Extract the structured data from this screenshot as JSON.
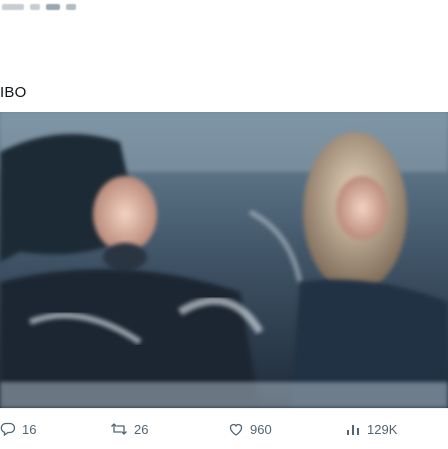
{
  "post": {
    "partial_text": "IBO",
    "media_description": "blurred photo"
  },
  "actions": {
    "replies": "16",
    "reposts": "26",
    "likes": "960",
    "views": "129K"
  },
  "icons": {
    "reply": "reply-icon",
    "repost": "repost-icon",
    "like": "heart-icon",
    "views": "views-icon"
  },
  "colors": {
    "icon_gray": "#536471",
    "text_dark": "#0f1419",
    "divider": "#eff3f4"
  }
}
